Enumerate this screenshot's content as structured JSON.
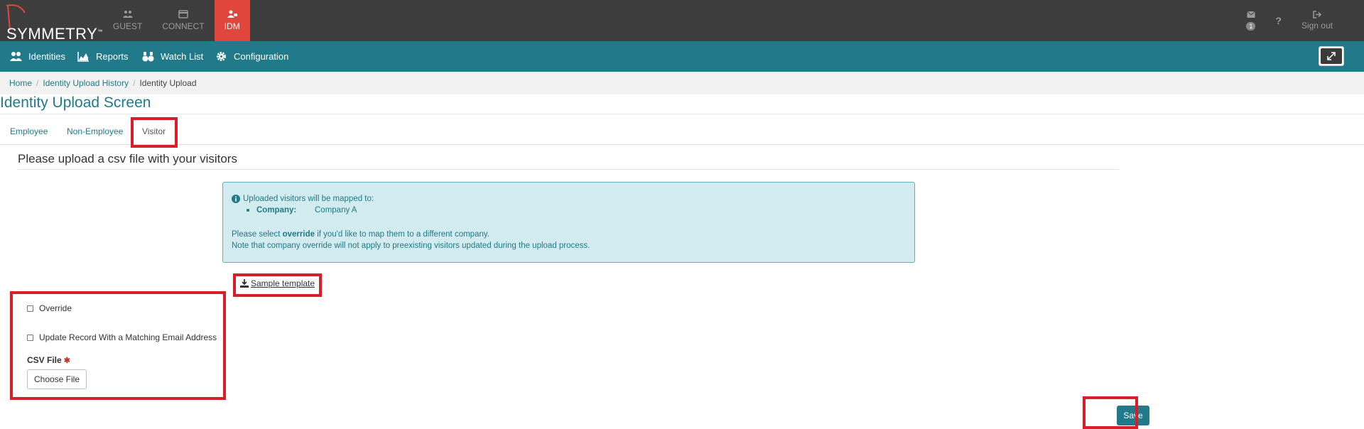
{
  "app": {
    "logo_text": "SYMMETRY",
    "logo_tm": "™",
    "top_nav": [
      {
        "label": "GUEST",
        "icon": "users-icon"
      },
      {
        "label": "CONNECT",
        "icon": "card-icon"
      },
      {
        "label": "IDM",
        "icon": "user-id-icon"
      }
    ],
    "notification_count": "1",
    "help_label": "?",
    "signout_label": "Sign out"
  },
  "main_nav": [
    {
      "label": "Identities",
      "icon": "users-icon"
    },
    {
      "label": "Reports",
      "icon": "area-chart-icon"
    },
    {
      "label": "Watch List",
      "icon": "binoculars-icon"
    },
    {
      "label": "Configuration",
      "icon": "gear-icon"
    }
  ],
  "breadcrumb": {
    "home": "Home",
    "history": "Identity Upload History",
    "current": "Identity Upload",
    "separator": "/"
  },
  "page_title": "Identity Upload Screen",
  "tabs": [
    "Employee",
    "Non-Employee",
    "Visitor"
  ],
  "active_tab": "Visitor",
  "section_title": "Please upload a csv file with your visitors",
  "info": {
    "line1": "Uploaded visitors will be mapped to:",
    "company_label": "Company:",
    "company_value": "Company A",
    "line2_prefix": "Please select ",
    "line2_bold": "override",
    "line2_suffix": " if you'd like to map them to a different company.",
    "line3": "Note that company override will not apply to preexisting visitors updated during the upload process."
  },
  "sample_template": "Sample template",
  "form": {
    "override_label": "Override",
    "override_checked": false,
    "update_label": "Update Record With a Matching Email Address",
    "update_checked": false,
    "csv_label": "CSV File",
    "required_mark": "✱",
    "choose_file": "Choose File"
  },
  "save_label": "Save",
  "colors": {
    "topbar": "#3d3d3d",
    "accent": "#217a8a",
    "idm_active": "#e0463c",
    "highlight": "#d91e2a",
    "info_bg": "#d2ecef"
  }
}
